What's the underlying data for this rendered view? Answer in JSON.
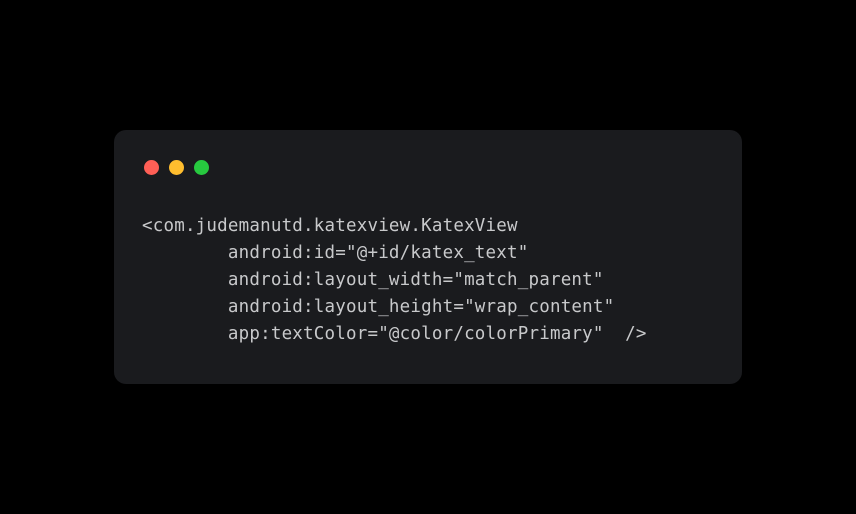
{
  "code": {
    "line1": "<com.judemanutd.katexview.KatexView",
    "line2": "        android:id=\"@+id/katex_text\"",
    "line3": "        android:layout_width=\"match_parent\"",
    "line4": "        android:layout_height=\"wrap_content\"",
    "line5": "        app:textColor=\"@color/colorPrimary\"  />"
  }
}
